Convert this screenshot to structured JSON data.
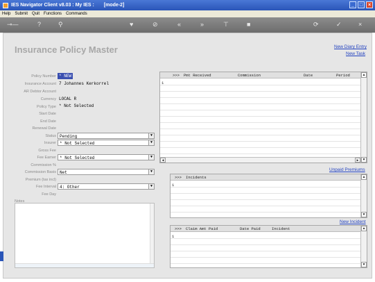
{
  "window": {
    "title": "IES Navigator Client v8.03 : My IES :",
    "mode": "[mode-2]"
  },
  "menu": [
    "Help",
    "Submit",
    "Quit",
    "Functions",
    "Commands"
  ],
  "page": {
    "title": "Insurance Policy Master",
    "links": {
      "new_diary": "New Diary Entry",
      "new_task": "New Task"
    }
  },
  "form": {
    "labels": {
      "policy_number": "Policy Number",
      "insurance_account": "Insurance Account",
      "ar_debtor": "AR Debtor Account",
      "currency": "Currency",
      "policy_type": "Policy Type",
      "start_date": "Start Date",
      "end_date": "End Date",
      "renewal_date": "Renewal Date",
      "status": "Status",
      "insurer": "Insurer",
      "gross_fee": "Gross Fee",
      "fee_earner": "Fee Earner",
      "commission_pct": "Commission %",
      "commission_basis": "Commission Basis",
      "premium": "Premium (tax incl)",
      "fee_interval": "Fee Interval",
      "fee_day": "Fee Day",
      "notes": "Notes"
    },
    "values": {
      "policy_number": "* NEW",
      "insurance_account": "7 Johannes Kerkorrel",
      "ar_debtor": "",
      "currency": "LOCAL R",
      "policy_type": "* Not Selected",
      "status": "Pending",
      "insurer": "* Not Selected",
      "fee_earner": "* Not Selected",
      "commission_basis": "Net",
      "fee_interval": "4: Other"
    }
  },
  "grids": {
    "premiums": {
      "headers": [
        ">>>",
        "Pmt Received",
        "Commission",
        "Date",
        "Period"
      ],
      "row1": "1"
    },
    "incidents": {
      "headers": [
        ">>>",
        "Incidents"
      ],
      "row1": "1",
      "link_unpaid": "Unpaid Premiums"
    },
    "claims": {
      "headers": [
        ">>>",
        "Claim Amt Paid",
        "Date Paid",
        "Incident"
      ],
      "row1": "1",
      "link_new_incident": "New Incident"
    }
  }
}
